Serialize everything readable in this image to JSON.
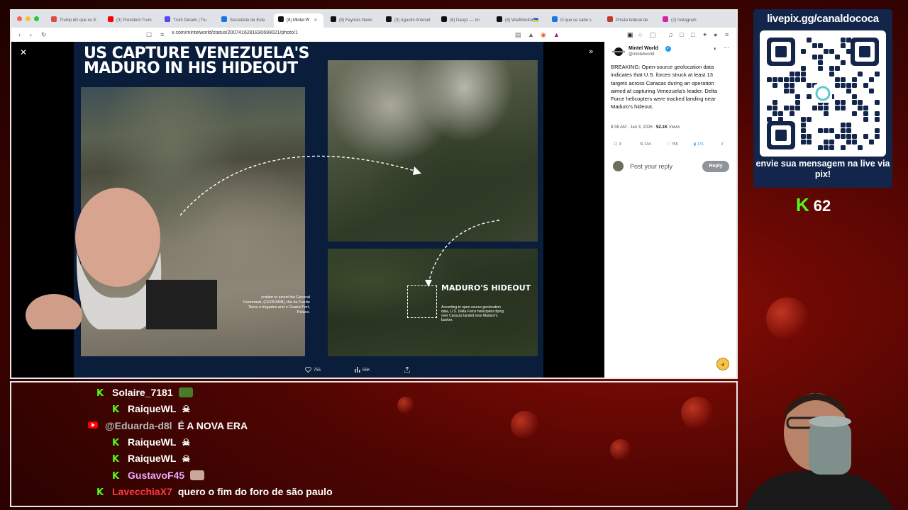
{
  "browser": {
    "tabs": [
      {
        "label": "Trump diz que os E",
        "active": false,
        "color": "#e04a3f"
      },
      {
        "label": "(3) President Trum",
        "active": false,
        "color": "#ff0000"
      },
      {
        "label": "Truth Details | Tru",
        "active": false,
        "color": "#5448ee"
      },
      {
        "label": "Secretário de Este",
        "active": false,
        "color": "#1a73e8"
      },
      {
        "label": "(8) Mintel W",
        "active": true,
        "color": "#111111"
      },
      {
        "label": "(8) Fayruks News",
        "active": false,
        "color": "#111111"
      },
      {
        "label": "(3) Agustin Antonet",
        "active": false,
        "color": "#111111"
      },
      {
        "label": "(8) Daoyz — on",
        "active": false,
        "color": "#111111"
      },
      {
        "label": "(8) WarMonitor🇺🇦",
        "active": false,
        "color": "#111111"
      },
      {
        "label": "O que se sabe s",
        "active": false,
        "color": "#1a73e8"
      },
      {
        "label": "Prisão federal de",
        "active": false,
        "color": "#c0392b"
      },
      {
        "label": "(2) Instagram",
        "active": false,
        "color": "#d6249f"
      }
    ],
    "url": "x.com/mintelworld/status/2007416281830699021/photo/1"
  },
  "media": {
    "headline": "US CAPTURE VENEZUELA'S MADURO IN HIS HIDEOUT",
    "hideout_title": "MADURO'S HIDEOUT",
    "hideout_text": "According to open-source geolocation data, U.S. Delta Force helicopters flying over Caracas landed near Maduro's bunker.",
    "caption_text": "eration to arrest the General Command, (CEOFANB), the he Fuerte Tiuna e brigades and e Guaira Port, Palace.",
    "likes": "755",
    "views": "55K"
  },
  "tweet": {
    "name": "Mintel World",
    "handle": "@mintelworld",
    "body": "BREAKING: Open-source geolocation data indicates that U.S. forces struck at least 13 targets across Caracas during an operation aimed at capturing Venezuela's leader. Delta Force helicopters were tracked landing near Maduro's hideout.",
    "time": "8:38 AM · Jan 3, 2026 ·",
    "views_count": "52.1K",
    "views_label": "Views",
    "replies": "3",
    "reposts": "134",
    "likes": "755",
    "bookmarks": "176",
    "reply_placeholder": "Post your reply",
    "reply_button": "Reply"
  },
  "qr": {
    "title": "livepix.gg/canaldococa",
    "message": "envie sua mensagem na live via pix!"
  },
  "kick": {
    "viewers": "62"
  },
  "chat": [
    {
      "platform": "kick",
      "user": "Solaire_7181",
      "color": "#ffffff",
      "type": "emote",
      "emote_color": "#4a7a2a"
    },
    {
      "platform": "kick",
      "user": "RaiqueWL",
      "color": "#ffffff",
      "type": "skull"
    },
    {
      "platform": "youtube",
      "user": "@Eduarda-d8l",
      "color": "#b8b8b8",
      "type": "text",
      "text": "É A NOVA ERA"
    },
    {
      "platform": "kick",
      "user": "RaiqueWL",
      "color": "#ffffff",
      "type": "skull"
    },
    {
      "platform": "kick",
      "user": "RaiqueWL",
      "color": "#ffffff",
      "type": "skull"
    },
    {
      "platform": "kick",
      "user": "GustavoF45",
      "color": "#e9a7ff",
      "type": "emote",
      "emote_color": "#c9a89a"
    },
    {
      "platform": "kick",
      "user": "LavecchiaX7",
      "color": "#ff3b3b",
      "type": "text",
      "text": "quero o fim do foro de são paulo"
    }
  ]
}
